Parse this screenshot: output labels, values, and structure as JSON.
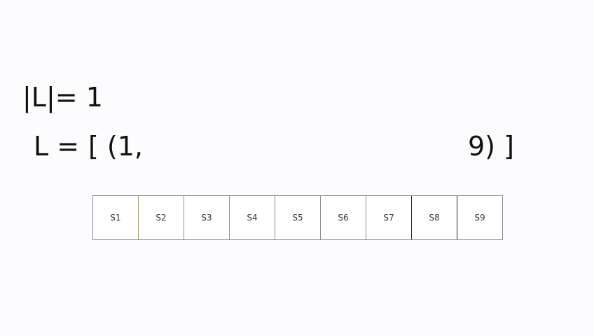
{
  "expression": {
    "size_line": "|L|= 1",
    "list_label": "L =",
    "list_open": "[ (1,",
    "list_close": "9) ]"
  },
  "cells": [
    "S1",
    "S2",
    "S3",
    "S4",
    "S5",
    "S6",
    "S7",
    "S8",
    "S9"
  ]
}
